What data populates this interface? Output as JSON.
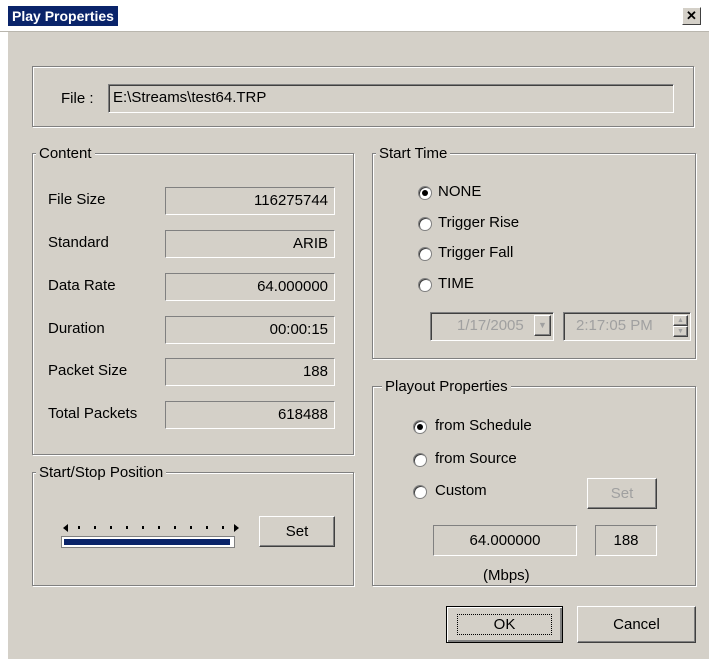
{
  "window": {
    "title": "Play Properties",
    "close_glyph": "✕"
  },
  "file": {
    "label": "File :",
    "value": "E:\\Streams\\test64.TRP"
  },
  "content": {
    "legend": "Content",
    "rows": [
      {
        "label": "File Size",
        "value": "116275744"
      },
      {
        "label": "Standard",
        "value": "ARIB"
      },
      {
        "label": "Data Rate",
        "value": "64.000000"
      },
      {
        "label": "Duration",
        "value": "00:00:15"
      },
      {
        "label": "Packet Size",
        "value": "188"
      },
      {
        "label": "Total Packets",
        "value": "618488"
      }
    ]
  },
  "start_stop": {
    "legend": "Start/Stop Position",
    "set_label": "Set"
  },
  "start_time": {
    "legend": "Start Time",
    "options": [
      "NONE",
      "Trigger Rise",
      "Trigger Fall",
      "TIME"
    ],
    "selected": "NONE",
    "date": "1/17/2005",
    "time": "2:17:05 PM"
  },
  "playout": {
    "legend": "Playout Properties",
    "options": [
      "from Schedule",
      "from Source",
      "Custom"
    ],
    "selected": "from Schedule",
    "set_label": "Set",
    "rate": "64.000000",
    "packet": "188",
    "unit": "(Mbps)"
  },
  "buttons": {
    "ok": "OK",
    "cancel": "Cancel"
  }
}
